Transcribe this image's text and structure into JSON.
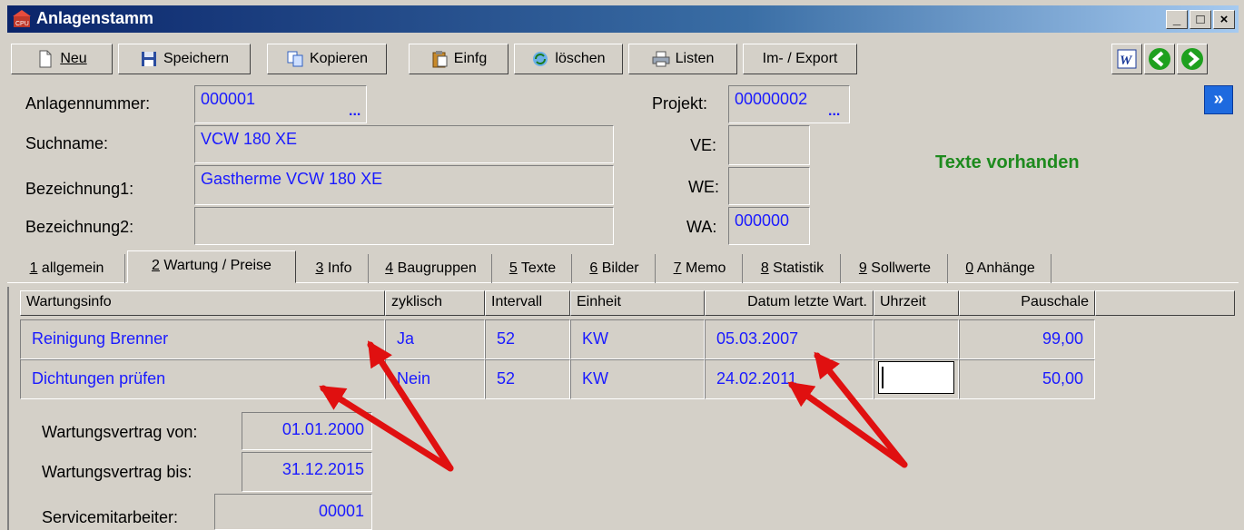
{
  "window": {
    "title": "Anlagenstamm",
    "minimize": "_",
    "maximize": "□",
    "close": "×"
  },
  "toolbar": {
    "new_label": "Neu",
    "save_label": "Speichern",
    "copy_label": "Kopieren",
    "paste_label": "Einfg",
    "delete_label": "löschen",
    "lists_label": "Listen",
    "impexp_label": "Im- / Export"
  },
  "header": {
    "anlagennummer_label": "Anlagennummer:",
    "anlagennummer": "000001",
    "suchname_label": "Suchname:",
    "suchname": "VCW 180 XE",
    "bez1_label": "Bezeichnung1:",
    "bez1": "Gastherme VCW 180 XE",
    "bez2_label": "Bezeichnung2:",
    "bez2": "",
    "projekt_label": "Projekt:",
    "projekt": "00000002",
    "ve_label": "VE:",
    "ve": "",
    "we_label": "WE:",
    "we": "",
    "wa_label": "WA:",
    "wa": "000000",
    "dots": "...",
    "texte_status": "Texte vorhanden",
    "next_glyph": "»"
  },
  "tabs": [
    {
      "key": "1",
      "label": " allgemein"
    },
    {
      "key": "2",
      "label": " Wartung / Preise"
    },
    {
      "key": "3",
      "label": " Info"
    },
    {
      "key": "4",
      "label": " Baugruppen"
    },
    {
      "key": "5",
      "label": " Texte"
    },
    {
      "key": "6",
      "label": " Bilder"
    },
    {
      "key": "7",
      "label": " Memo"
    },
    {
      "key": "8",
      "label": " Statistik"
    },
    {
      "key": "9",
      "label": " Sollwerte"
    },
    {
      "key": "0",
      "label": " Anhänge"
    }
  ],
  "grid": {
    "columns": [
      "Wartungsinfo",
      "zyklisch",
      "Intervall",
      "Einheit",
      "Datum letzte Wart.",
      "Uhrzeit",
      "Pauschale"
    ],
    "rows": [
      [
        "Reinigung Brenner",
        "Ja",
        "52",
        "KW",
        "05.03.2007",
        "",
        "99,00"
      ],
      [
        "Dichtungen prüfen",
        "Nein",
        "52",
        "KW",
        "24.02.2011",
        "",
        "50,00"
      ]
    ]
  },
  "contract": {
    "von_label": "Wartungsvertrag von:",
    "von": "01.01.2000",
    "bis_label": "Wartungsvertrag bis:",
    "bis": "31.12.2015",
    "service_label": "Servicemitarbeiter:",
    "service": "00001"
  },
  "colors": {
    "value_text": "#1a1aff",
    "status_green": "#1e8a1e",
    "annotation_red": "#e01010"
  }
}
